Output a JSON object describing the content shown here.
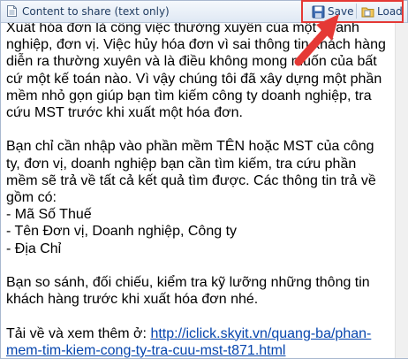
{
  "window": {
    "title": "Content to share (text only)"
  },
  "toolbar": {
    "save_label": "Save",
    "load_label": "Load"
  },
  "content": {
    "paragraph1": "Xuất hóa đơn là công việc thường xuyên của một doanh nghiệp, đơn vị. Việc hủy hóa đơn vì sai thông tin khách hàng diễn ra thường xuyên và là điều không mong muốn của bất cứ một kế toán nào. Vì vậy chúng tôi đã xây dựng một phần mềm nhỏ gọn giúp bạn tìm kiếm công ty doanh nghiệp, tra cứu MST trước khi xuất một hóa đơn.",
    "paragraph2": "Bạn chỉ cần nhập vào phần mềm TÊN hoặc MST của công ty, đơn vị, doanh nghiệp bạn cần tìm kiếm, tra cứu phần mềm sẽ trả về tất cả kết quả tìm được. Các thông tin trả về gồm có:",
    "list": [
      "- Mã Số Thuế",
      "- Tên Đơn vị, Doanh nghiệp, Công ty",
      "- Địa Chỉ"
    ],
    "paragraph3": "Bạn so sánh, đối chiếu, kiểm tra kỹ lưỡng những thông tin khách hàng trước khi xuất hóa đơn nhé.",
    "footer_prefix": "Tải về và xem thêm ở: ",
    "footer_link": "http://iclick.skyit.vn/quang-ba/phan-mem-tim-kiem-cong-ty-tra-cuu-mst-t871.html"
  },
  "colors": {
    "highlight_box": "#e53935",
    "arrow": "#e53935",
    "link": "#0645ad"
  },
  "icons": {
    "title": "document-icon",
    "save": "save-icon",
    "load": "load-icon",
    "annotation": "arrow-icon"
  }
}
